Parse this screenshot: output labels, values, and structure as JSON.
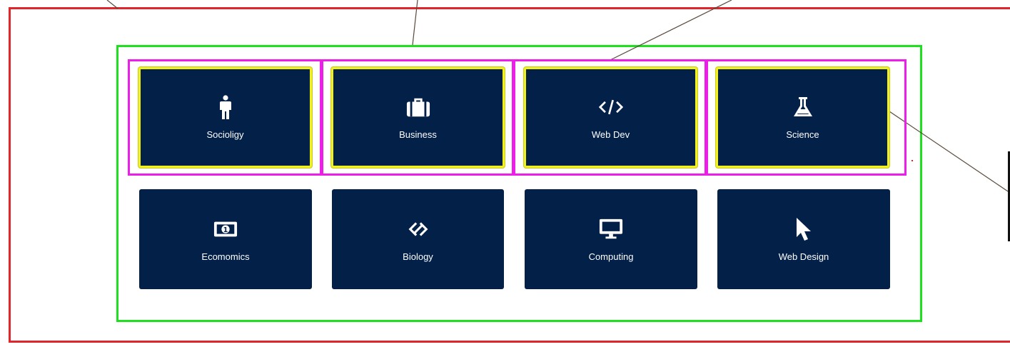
{
  "tiles": [
    {
      "label": "Socioligy",
      "icon": "person-icon"
    },
    {
      "label": "Business",
      "icon": "briefcase-icon"
    },
    {
      "label": "Web Dev",
      "icon": "code-icon"
    },
    {
      "label": "Science",
      "icon": "flask-icon"
    },
    {
      "label": "Ecomomics",
      "icon": "money-icon"
    },
    {
      "label": "Biology",
      "icon": "link-icon"
    },
    {
      "label": "Computing",
      "icon": "monitor-icon"
    },
    {
      "label": "Web Design",
      "icon": "cursor-icon"
    }
  ],
  "colors": {
    "tile_bg": "#032048",
    "outer_frame": "#e0262b",
    "grid_frame": "#1fe01f",
    "row_outline": "#ee1ee9",
    "tile_highlight": "#f1f11d"
  }
}
